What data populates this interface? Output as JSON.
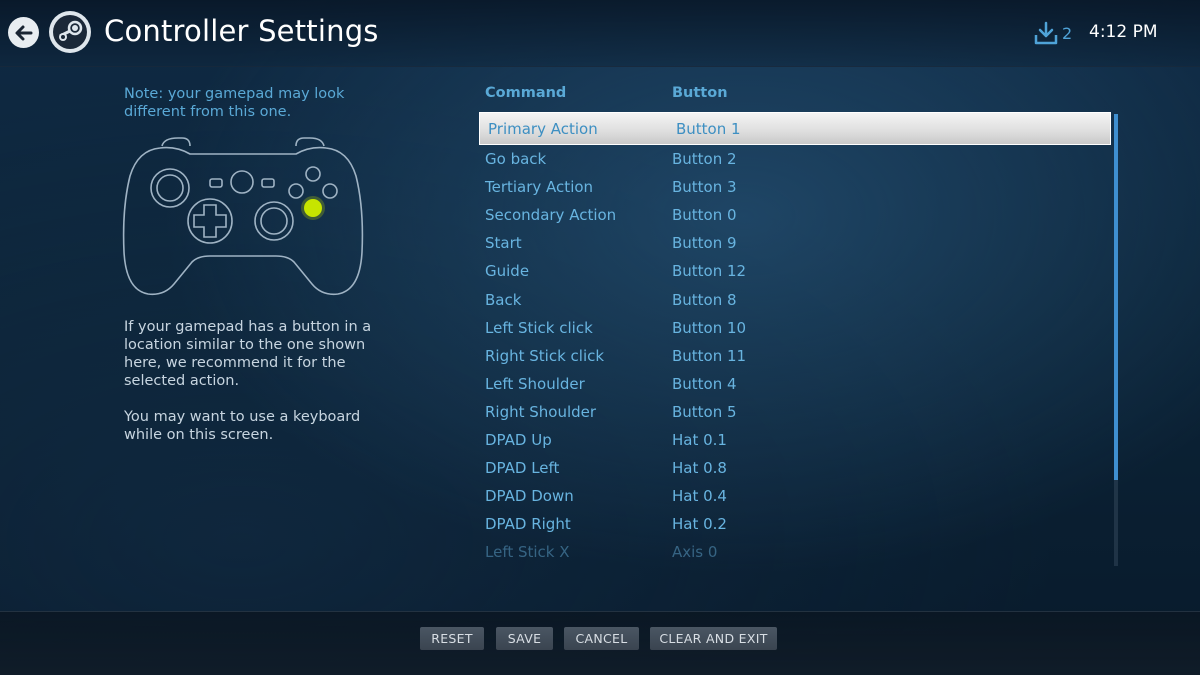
{
  "header": {
    "title": "Controller Settings",
    "downloads_count": "2",
    "clock": "4:12 PM"
  },
  "left": {
    "note": "Note: your gamepad may look different from this one.",
    "help_1": "If your gamepad has a button in a location similar to the one shown here, we recommend it for the selected action.",
    "help_2": "You may want to use a keyboard while on this screen."
  },
  "table": {
    "headers": {
      "command": "Command",
      "button": "Button"
    },
    "selected_index": 0,
    "rows": [
      {
        "command": "Primary Action",
        "button": "Button 1"
      },
      {
        "command": "Go back",
        "button": "Button 2"
      },
      {
        "command": "Tertiary Action",
        "button": "Button 3"
      },
      {
        "command": "Secondary Action",
        "button": "Button 0"
      },
      {
        "command": "Start",
        "button": "Button 9"
      },
      {
        "command": "Guide",
        "button": "Button 12"
      },
      {
        "command": "Back",
        "button": "Button 8"
      },
      {
        "command": "Left Stick click",
        "button": "Button 10"
      },
      {
        "command": "Right Stick click",
        "button": "Button 11"
      },
      {
        "command": "Left Shoulder",
        "button": "Button 4"
      },
      {
        "command": "Right Shoulder",
        "button": "Button 5"
      },
      {
        "command": "DPAD Up",
        "button": "Hat 0.1"
      },
      {
        "command": "DPAD Left",
        "button": "Hat 0.8"
      },
      {
        "command": "DPAD Down",
        "button": "Hat 0.4"
      },
      {
        "command": "DPAD Right",
        "button": "Hat 0.2"
      },
      {
        "command": "Left Stick X",
        "button": "Axis 0"
      }
    ]
  },
  "footer": {
    "reset": "RESET",
    "save": "SAVE",
    "cancel": "CANCEL",
    "clear_and_exit": "CLEAR AND EXIT"
  },
  "colors": {
    "accent": "#5aa9d6",
    "highlight": "#c6e500",
    "scroll_thumb": "#3f8fd0"
  },
  "icons": {
    "back": "back-arrow-icon",
    "logo": "steam-logo-icon",
    "downloads": "download-icon",
    "gamepad": "gamepad-diagram"
  }
}
